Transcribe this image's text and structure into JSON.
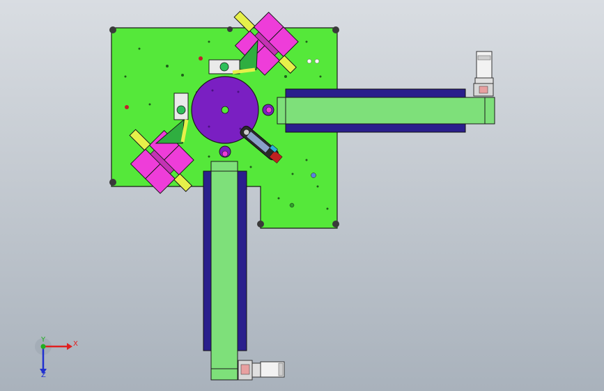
{
  "viewport": {
    "background_top": "#d9dde2",
    "background_bottom": "#a9b2bc"
  },
  "colors": {
    "base_plate": "#55e83a",
    "turntable": "#7a1fc2",
    "conveyor_belt": "#7ee07a",
    "conveyor_frame": "#2a1f8c",
    "gripper_pads": "#ee3dd9",
    "cylinders": "#e6f04a",
    "outline": "#1a1a1a"
  },
  "icons": {
    "triad": "coordinate-triad-icon"
  },
  "triad": {
    "x_label": "X",
    "y_label": "Y",
    "z_label": "Z",
    "x_color": "#e02020",
    "y_color": "#20b020",
    "z_color": "#2030d0"
  }
}
